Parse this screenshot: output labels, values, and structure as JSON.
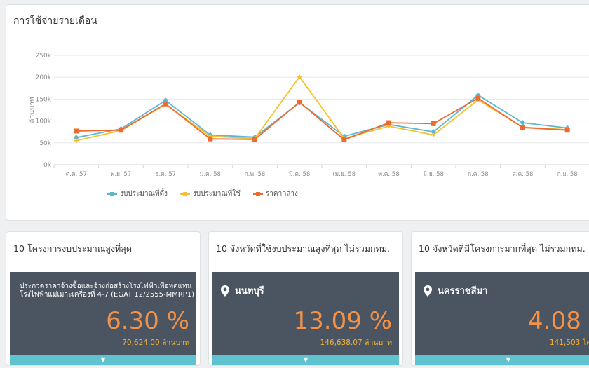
{
  "chart_panel": {
    "title": "การใช้จ่ายรายเดือน"
  },
  "chart_data": {
    "type": "line",
    "title": "การใช้จ่ายรายเดือน",
    "ylabel": "ล้านบาท",
    "categories": [
      "ต.ค. 57",
      "พ.ย. 57",
      "ธ.ค. 57",
      "ม.ค. 58",
      "ก.พ. 58",
      "มี.ค. 58",
      "เม.ย. 58",
      "พ.ค. 58",
      "มิ.ย. 58",
      "ก.ค. 58",
      "ส.ค. 58",
      "ก.ย. 58"
    ],
    "y_ticks": [
      "0k",
      "50k",
      "100k",
      "150k",
      "200k",
      "250k"
    ],
    "ylim": [
      0,
      250000
    ],
    "grid": true,
    "legend_position": "bottom",
    "series": [
      {
        "name": "งบประมาณที่ตั้ง",
        "color": "#5bb8d4",
        "marker": "diamond",
        "values": [
          62000,
          82000,
          147000,
          68000,
          63000,
          142000,
          65000,
          92000,
          75000,
          159000,
          96000,
          84000
        ]
      },
      {
        "name": "งบประมาณที่ใช้",
        "color": "#f5c12e",
        "marker": "plus",
        "values": [
          55000,
          78000,
          138000,
          65000,
          60000,
          201000,
          60000,
          88000,
          68000,
          148000,
          86000,
          80000
        ]
      },
      {
        "name": "ราคากลาง",
        "color": "#ee6a2f",
        "marker": "square",
        "values": [
          77000,
          79000,
          139000,
          59000,
          58000,
          143000,
          57000,
          96000,
          94000,
          152000,
          85000,
          79000
        ]
      }
    ]
  },
  "cards": [
    {
      "title": "10 โครงการงบประมาณสูงที่สุด",
      "name_line1": "ประกวดราคาจ้างซื้อและจ้างก่อสร้างโรงไฟฟ้าเพื่อทดแทน",
      "name_line2": "โรงไฟฟ้าแม่เมาะเครื่องที่ 4-7 (EGAT 12/2555-MMRP1)",
      "percent": "6.30 %",
      "value": "70,624.00 ล้านบาท",
      "expand_icon": "▼"
    },
    {
      "title": "10 จังหวัดที่ใช้งบประมาณสูงที่สุด ไม่รวมกทม.",
      "province": "นนทบุรี",
      "percent": "13.09 %",
      "value": "146,638.07 ล้านบาท",
      "expand_icon": "▼"
    },
    {
      "title": "10 จังหวัดที่มีโครงการมากที่สุด ไม่รวมกทม.",
      "province": "นครราชสีมา",
      "percent": "4.08 %",
      "value": "141,503 โครงการ",
      "expand_icon": "▼"
    }
  ],
  "colors": {
    "card_body": "#4b5461",
    "accent_orange": "#f39247",
    "accent_yellow": "#f5b335",
    "footer_teal": "#5ec3cf"
  }
}
